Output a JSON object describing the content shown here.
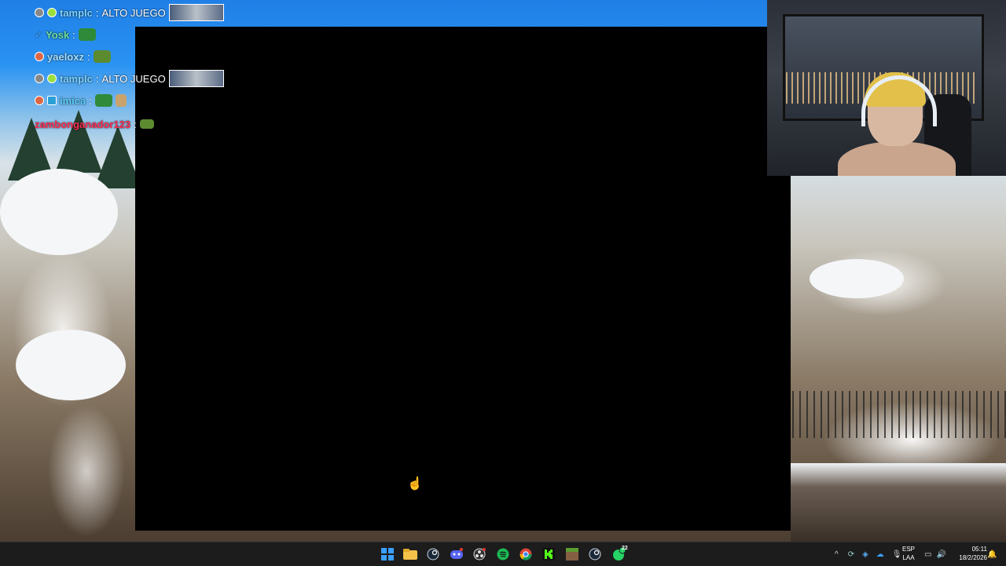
{
  "chat": {
    "messages": [
      {
        "user": "tamplc",
        "text": "ALTO JUEGO",
        "color": "#7fd3ff",
        "has_thumb": true
      },
      {
        "user": "Yosk",
        "text": "",
        "color": "#6fe0a0",
        "emote": "frog"
      },
      {
        "user": "yaeloxz",
        "text": "",
        "color": "#a8e0ff",
        "emote": "frog"
      },
      {
        "user": "tamplc",
        "text": "ALTO JUEGO",
        "color": "#7fd3ff",
        "has_thumb": true
      },
      {
        "user": "imica",
        "text": "",
        "color": "#5ad1ff",
        "emote": "frog-popcorn"
      },
      {
        "user": "zambonganador123",
        "text": "",
        "color": "#ff2d55",
        "emote": "frog"
      }
    ]
  },
  "taskbar": {
    "apps": [
      "windows-start",
      "file-explorer",
      "steam",
      "discord",
      "obs",
      "spotify",
      "chrome",
      "kick",
      "minecraft",
      "steam-2",
      "whatsapp"
    ],
    "whatsapp_badge": "22",
    "language_line1": "ESP",
    "language_line2": "LAA",
    "time": "05:11",
    "date": "18/2/2026"
  },
  "colors": {
    "taskbar_bg": "#1c1c1c",
    "app_window_bg": "#000000"
  }
}
